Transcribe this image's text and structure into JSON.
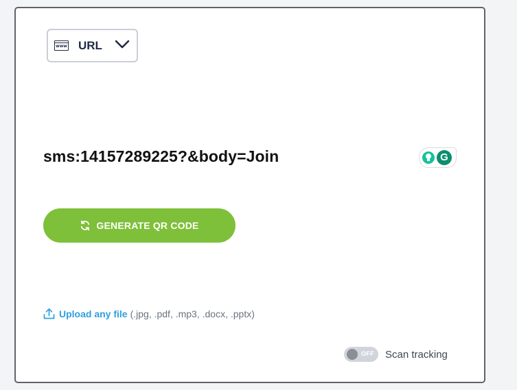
{
  "type_selector": {
    "icon_text": "www",
    "label": "URL"
  },
  "content": {
    "value": "sms:14157289225?&body=Join"
  },
  "grammarly": {
    "letter": "G"
  },
  "generate_button": {
    "label": "GENERATE QR CODE"
  },
  "upload": {
    "link_text": "Upload any file",
    "hint": "(.jpg, .pdf, .mp3, .docx, .pptx)"
  },
  "scan_tracking": {
    "toggle_state": "OFF",
    "label": "Scan tracking"
  },
  "colors": {
    "accent_green": "#7ec03a",
    "link_blue": "#2d9fe0",
    "grammarly_green": "#15c39a"
  }
}
